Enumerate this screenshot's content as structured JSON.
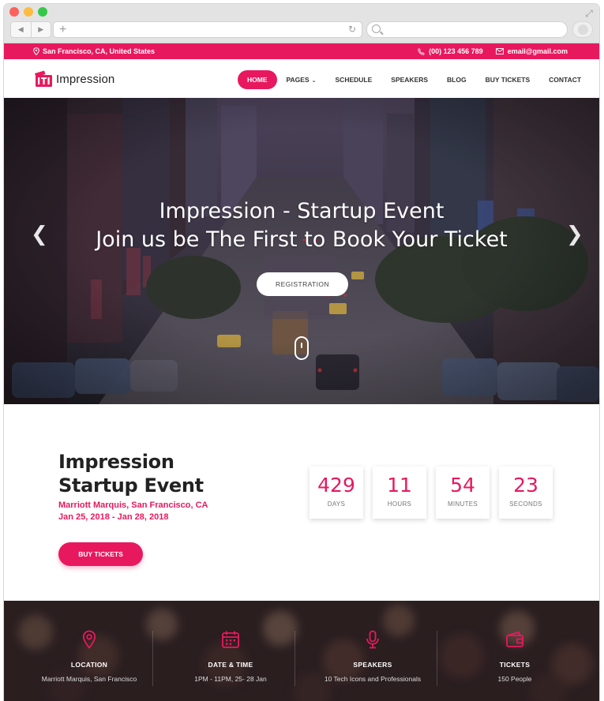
{
  "browser": {
    "nav_back": "◀",
    "nav_forward": "▶",
    "new_tab": "+",
    "reload": "↻",
    "expand": "⤢"
  },
  "topbar": {
    "location": "San Francisco, CA, United States",
    "phone": "(00) 123 456 789",
    "email": "email@gmail.com",
    "location_icon": "map-pin-icon",
    "phone_icon": "phone-icon",
    "email_icon": "envelope-icon"
  },
  "brand": {
    "name": "Impression",
    "accent_color": "#e8185f"
  },
  "nav": {
    "items": [
      {
        "label": "HOME",
        "active": true
      },
      {
        "label": "PAGES",
        "dropdown": true
      },
      {
        "label": "SCHEDULE"
      },
      {
        "label": "SPEAKERS"
      },
      {
        "label": "BLOG"
      },
      {
        "label": "BUY TICKETS"
      },
      {
        "label": "CONTACT"
      }
    ]
  },
  "hero": {
    "line1": "Impression - Startup Event",
    "line2": "Join us be The First to Book Your Ticket",
    "button": "REGISTRATION",
    "prev": "❮",
    "next": "❯"
  },
  "event": {
    "title_line1": "Impression",
    "title_line2": "Startup Event",
    "venue": "Marriott Marquis, San Francisco, CA",
    "dates": "Jan 25, 2018 - Jan 28, 2018",
    "buy_button": "BUY TICKETS"
  },
  "countdown": [
    {
      "value": "429",
      "label": "DAYS"
    },
    {
      "value": "11",
      "label": "HOURS"
    },
    {
      "value": "54",
      "label": "MINUTES"
    },
    {
      "value": "23",
      "label": "SECONDS"
    }
  ],
  "features": [
    {
      "title": "LOCATION",
      "detail": "Marriott Marquis, San Francisco",
      "icon": "location-pin-icon"
    },
    {
      "title": "DATE & TIME",
      "detail": "1PM - 11PM, 25- 28 Jan",
      "icon": "calendar-icon"
    },
    {
      "title": "SPEAKERS",
      "detail": "10 Tech Icons and Professionals",
      "icon": "microphone-icon"
    },
    {
      "title": "TICKETS",
      "detail": "150 People",
      "icon": "wallet-icon"
    }
  ]
}
